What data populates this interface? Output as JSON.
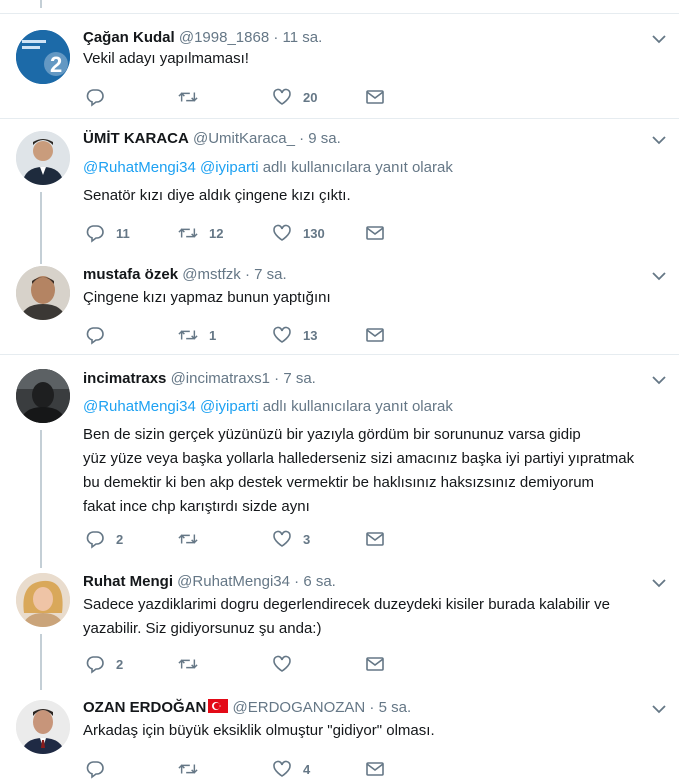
{
  "colors": {
    "accent": "#1da1f2",
    "muted": "#657786",
    "text": "#14171a",
    "divider": "#e6ecf0"
  },
  "tweets": [
    {
      "name": "Çağan Kudal",
      "handle": "@1998_1868",
      "time": "11 sa.",
      "avatar": "avatar-badge-2",
      "text": "Vekil adayı yapılmaması!",
      "replies": "",
      "retweets": "",
      "likes": "20"
    },
    {
      "name": "ÜMİT KARACA",
      "handle": "@UmitKaraca_",
      "time": "9 sa.",
      "avatar": "avatar-man-suit",
      "reply_to": {
        "mention1": "@RuhatMengi34",
        "mention2": "@iyiparti",
        "suffix": "adlı kullanıcılara yanıt olarak"
      },
      "text": "Senatör kızı diye aldık çingene kızı çıktı.",
      "replies": "11",
      "retweets": "12",
      "likes": "130"
    },
    {
      "name": "mustafa özek",
      "handle": "@mstfzk",
      "time": "7 sa.",
      "avatar": "avatar-man-face",
      "text": "Çingene kızı yapmaz bunun yaptığını",
      "replies": "",
      "retweets": "1",
      "likes": "13"
    },
    {
      "name": "incimatraxs",
      "handle": "@incimatraxs1",
      "time": "7 sa.",
      "avatar": "avatar-dark-silhouette",
      "reply_to": {
        "mention1": "@RuhatMengi34",
        "mention2": "@iyiparti",
        "suffix": "adlı kullanıcılara yanıt olarak"
      },
      "text_lines": [
        "Ben de  sizin  gerçek  yüzünüzü bir yazıyla gördüm bir  sorununuz varsa gidip",
        "yüz yüze veya başka yollarla hallederseniz sizi amacınız başka iyi partiyi yıpratmak",
        "bu  demektir ki ben akp destek vermektir be haklısınız haksızsınız demiyorum",
        "fakat ince chp karıştırdı sizde aynı"
      ],
      "replies": "2",
      "retweets": "",
      "likes": "3"
    },
    {
      "name": "Ruhat Mengi",
      "handle": "@RuhatMengi34",
      "time": "6 sa.",
      "avatar": "avatar-blonde-woman",
      "text_lines": [
        "Sadece yazdiklarimi dogru degerlendirecek duzeydeki kisiler burada kalabilir ve",
        "yazabilir. Siz gidiyorsunuz şu anda:)"
      ],
      "replies": "2",
      "retweets": "",
      "likes": ""
    },
    {
      "name": "OZAN ERDOĞAN",
      "handle": "@ERDOGANOZAN",
      "time": "5 sa.",
      "avatar": "avatar-man-suit-2",
      "flag": "turkey-flag-icon",
      "text": "Arkadaş için büyük eksiklik olmuştur \"gidiyor\" olması.",
      "replies": "",
      "retweets": "",
      "likes": "4"
    }
  ]
}
